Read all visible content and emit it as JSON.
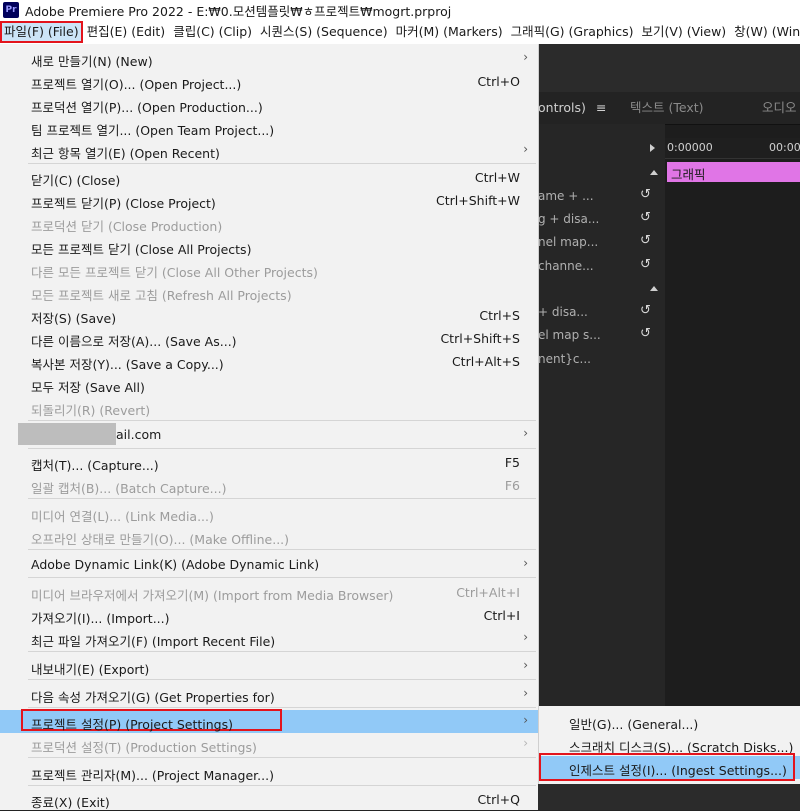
{
  "titlebar": {
    "logo": "Pr",
    "title": "Adobe Premiere Pro 2022 - E:₩0.모션템플릿₩ㅎ프로젝트₩mogrt.prproj"
  },
  "menubar": {
    "items": [
      "파일(F) (File)",
      "편집(E) (Edit)",
      "클립(C) (Clip)",
      "시퀀스(S) (Sequence)",
      "마커(M) (Markers)",
      "그래픽(G) (Graphics)",
      "보기(V) (View)",
      "창(W) (Window)"
    ]
  },
  "background": {
    "tabs": [
      "ontrols)",
      "텍스트 (Text)",
      "오디오"
    ],
    "panel_menu_icon": "≡",
    "timecode_1": "0:00000",
    "timecode_2": "00:00",
    "clip_label": "그래픽",
    "props": [
      "ame + ...",
      "g + disa...",
      "nel map...",
      "channe...",
      "+ disa...",
      "el map s...",
      "nent}c..."
    ]
  },
  "file_menu": {
    "new": {
      "label": "새로 만들기(N) (New)"
    },
    "open_project": {
      "label": "프로젝트 열기(O)... (Open Project...)",
      "shortcut": "Ctrl+O"
    },
    "open_production": {
      "label": "프로덕션 열기(P)... (Open Production...)"
    },
    "open_team": {
      "label": "팀 프로젝트 열기... (Open Team Project...)"
    },
    "open_recent": {
      "label": "최근 항목 열기(E) (Open Recent)"
    },
    "close": {
      "label": "닫기(C) (Close)",
      "shortcut": "Ctrl+W"
    },
    "close_project": {
      "label": "프로젝트 닫기(P) (Close Project)",
      "shortcut": "Ctrl+Shift+W"
    },
    "close_production": {
      "label": "프로덕션 닫기 (Close Production)"
    },
    "close_all": {
      "label": "모든 프로젝트 닫기 (Close All Projects)"
    },
    "close_other": {
      "label": "다른 모든 프로젝트 닫기 (Close All Other Projects)"
    },
    "refresh_all": {
      "label": "모든 프로젝트 새로 고침 (Refresh All Projects)"
    },
    "save": {
      "label": "저장(S) (Save)",
      "shortcut": "Ctrl+S"
    },
    "save_as": {
      "label": "다른 이름으로 저장(A)... (Save As...)",
      "shortcut": "Ctrl+Shift+S"
    },
    "save_copy": {
      "label": "복사본 저장(Y)... (Save a Copy...)",
      "shortcut": "Ctrl+Alt+S"
    },
    "save_all": {
      "label": "모두 저장 (Save All)"
    },
    "revert": {
      "label": "되돌리기(R) (Revert)"
    },
    "account": {
      "label": "ail.com"
    },
    "capture": {
      "label": "캡처(T)... (Capture...)",
      "shortcut": "F5"
    },
    "batch_capture": {
      "label": "일괄 캡처(B)... (Batch Capture...)",
      "shortcut": "F6"
    },
    "link_media": {
      "label": "미디어 연결(L)... (Link Media...)"
    },
    "make_offline": {
      "label": "오프라인 상태로 만들기(O)... (Make Offline...)"
    },
    "dynamic_link": {
      "label": "Adobe Dynamic Link(K) (Adobe Dynamic Link)"
    },
    "import_browser": {
      "label": "미디어 브라우저에서 가져오기(M) (Import from Media Browser)",
      "shortcut": "Ctrl+Alt+I"
    },
    "import": {
      "label": "가져오기(I)... (Import...)",
      "shortcut": "Ctrl+I"
    },
    "import_recent": {
      "label": "최근 파일 가져오기(F) (Import Recent File)"
    },
    "export": {
      "label": "내보내기(E) (Export)"
    },
    "get_properties": {
      "label": "다음 속성 가져오기(G) (Get Properties for)"
    },
    "project_settings": {
      "label": "프로젝트 설정(P) (Project Settings)"
    },
    "production_settings": {
      "label": "프로덕션 설정(T) (Production Settings)"
    },
    "project_manager": {
      "label": "프로젝트 관리자(M)... (Project Manager...)"
    },
    "exit": {
      "label": "종료(X) (Exit)",
      "shortcut": "Ctrl+Q"
    }
  },
  "submenu": {
    "general": "일반(G)... (General...)",
    "scratch": "스크래치 디스크(S)... (Scratch Disks...)",
    "ingest": "인제스트 설정(I)... (Ingest Settings...)"
  },
  "colors": {
    "highlight": "#91c9f7",
    "annotation_red": "#e3141c",
    "clip_pink": "#e075e6"
  }
}
